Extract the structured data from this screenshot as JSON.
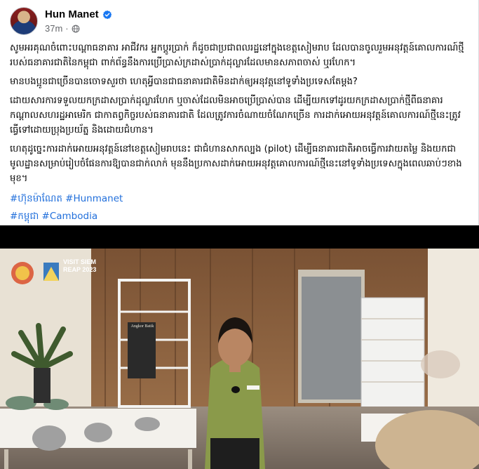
{
  "post": {
    "author": "Hun Manet",
    "time": "37m",
    "body": [
      "សូមអរគុណចំពោះបណ្ដាធនាគារ អាជីវករ អ្នកប្ដូរប្រាក់ ក៏ដូចជាប្រជាពលរដ្ឋនៅក្នុងខេត្តសៀមរាប ដែលបានចូលរួមអនុវត្តន៍គោលការណ៍ថ្មីរបស់ធនាគារជាតិនៃកម្ពុជា ពាក់ព័ន្ធនឹងការប្រើប្រាស់ក្រដាស់ប្រាក់ដុល្លារដែលមានសភាពចាស់ ឬរហែក។",
      "មានបងប្អូនជាច្រើនបានចោទសួរថា ហេតុអ្វីបានជាធនាគារជាតិមិនដាក់ឲ្យអនុវត្តនៅទូទាំងប្រទេសតែម្ដង?",
      "ដោយសារការទទួលយកក្រដាសប្រាក់ដុល្លារហែក ឬចាស់ដែលមិនអាចប្រើប្រាស់បាន ដើម្បីយកទៅដូរយកក្រដាសប្រាក់ថ្មីពីធនាគារកណ្ដាលសហរដ្ឋអាមេរិក ជាកាតព្វកិច្ចរបស់ធនាគារជាតិ ដែលត្រូវការចំណាយចំណែកច្រើន ការដាក់អោយអនុវត្តន៍គោលការណ៍ថ្មីនេះត្រូវធ្វើទៅដោយប្រុងប្រយ័ត្ន និងដោយជំហាន។",
      "ហេតុដូច្នេះការដាក់អោយអនុវត្តន៍នៅខេត្តសៀមរាបនេះ ជាជំហានសាកល្បង (pilot) ដើម្បីធនាគារជាតិអាចធ្វើការវាយតម្លៃ និងយកជាមូលដ្ឋានសម្រាប់រៀបចំផែនការឱ្យបានជាក់លាក់ មុននឹងប្រកាសដាក់អោយអនុវត្តគោលការណ៍ថ្មីនេះនៅទូទាំងប្រទេសក្នុងពេលឆាប់ៗខាងមុខ។"
    ],
    "hashtags_line1": [
      "#ហ៊ុនម៉ាណែត",
      "#Hunmanet"
    ],
    "hashtags_line2": [
      "#កម្ពុជា",
      "#Cambodia"
    ]
  },
  "video": {
    "overlay_logo_text": "VISIT SIEM REAP 2023",
    "sign_text": "Angkor Batik"
  },
  "colors": {
    "link": "#216fdb",
    "verified": "#1877f2",
    "meta": "#65676b"
  }
}
